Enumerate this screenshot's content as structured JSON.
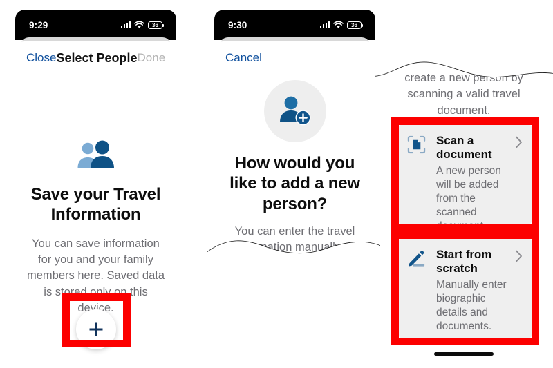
{
  "meta": {
    "accent_blue": "#11519e",
    "highlight_red": "#fc0000",
    "card_gray": "#efefef",
    "muted_text": "#6e6e73"
  },
  "panel1": {
    "status": {
      "time": "9:29",
      "battery": "36",
      "signal_icon": "cellular-bars-icon",
      "wifi_icon": "wifi-icon",
      "battery_icon": "battery-icon"
    },
    "nav": {
      "close_label": "Close",
      "title": "Select People",
      "done_label": "Done"
    },
    "icon": "two-people-icon",
    "headline": "Save your Travel Information",
    "body": "You can save information for you and your family members here. Saved data is stored only on this device.",
    "fab_icon": "plus-icon"
  },
  "panel2": {
    "status": {
      "time": "9:30",
      "battery": "36",
      "signal_icon": "cellular-bars-icon",
      "wifi_icon": "wifi-icon",
      "battery_icon": "battery-icon"
    },
    "nav": {
      "cancel_label": "Cancel"
    },
    "icon": "person-add-icon",
    "headline": "How would you like to add a new person?",
    "body": "You can enter the travel information manually or create a new person by"
  },
  "panel3": {
    "body_continued": "create a new person by scanning a valid travel document.",
    "options": [
      {
        "icon": "scan-document-icon",
        "title": "Scan a document",
        "desc": "A new person will be added from the scanned document.",
        "chevron": "chevron-right-icon"
      },
      {
        "icon": "pencil-edit-icon",
        "title": "Start from scratch",
        "desc": "Manually enter biographic details and documents.",
        "chevron": "chevron-right-icon"
      }
    ]
  }
}
